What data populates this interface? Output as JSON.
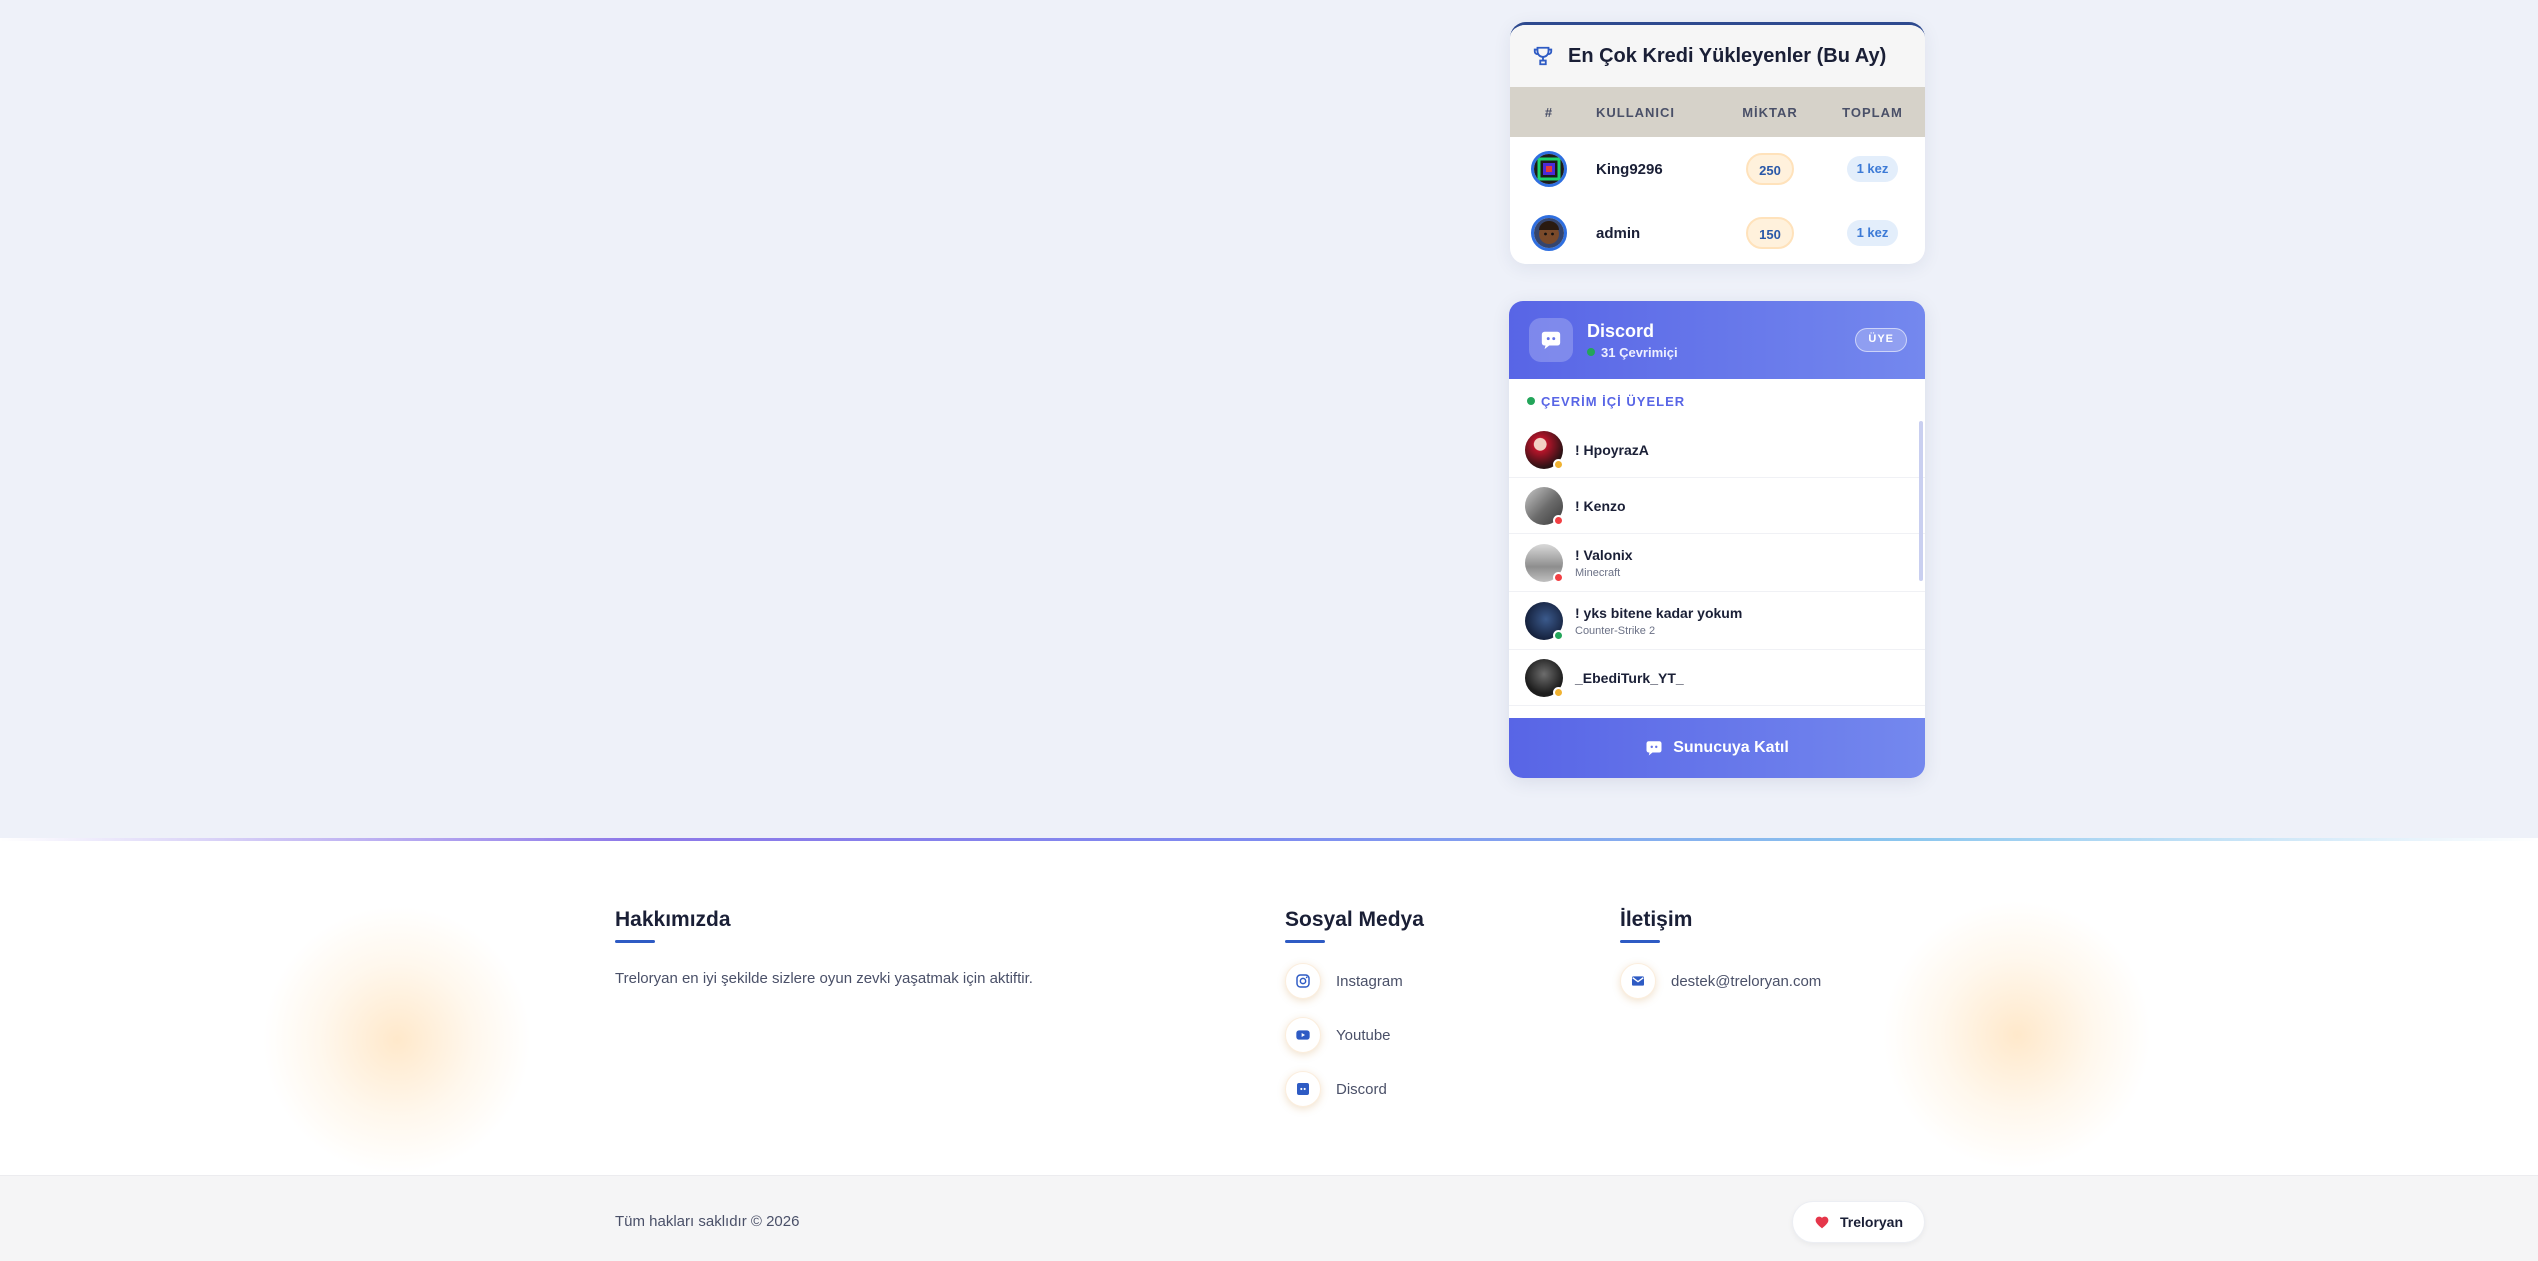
{
  "credits": {
    "title": "En Çok Kredi Yükleyenler (Bu Ay)",
    "columns": [
      "#",
      "KULLANICI",
      "MİKTAR",
      "TOPLAM"
    ],
    "rows": [
      {
        "user": "King9296",
        "amount": "250",
        "total": "1 kez"
      },
      {
        "user": "admin",
        "amount": "150",
        "total": "1 kez"
      }
    ]
  },
  "discord": {
    "name": "Discord",
    "online_text": "31 Çevrimiçi",
    "member_button": "ÜYE",
    "section_label": "ÇEVRİM İÇİ ÜYELER",
    "members": [
      {
        "name": "! HpoyrazA",
        "game": "",
        "status": "idle"
      },
      {
        "name": "! Kenzo",
        "game": "",
        "status": "dnd"
      },
      {
        "name": "! Valonix",
        "game": "Minecraft",
        "status": "dnd"
      },
      {
        "name": "! yks bitene kadar yokum",
        "game": "Counter-Strike 2",
        "status": "online"
      },
      {
        "name": "_EbediTurk_YT_",
        "game": "",
        "status": "idle"
      }
    ],
    "join_button": "Sunucuya Katıl"
  },
  "footer": {
    "about": {
      "title": "Hakkımızda",
      "text": "Treloryan en iyi şekilde sizlere oyun zevki yaşatmak için aktiftir."
    },
    "social": {
      "title": "Sosyal Medya",
      "links": [
        {
          "label": "Instagram",
          "icon": "instagram-icon"
        },
        {
          "label": "Youtube",
          "icon": "youtube-icon"
        },
        {
          "label": "Discord",
          "icon": "discord-icon"
        }
      ]
    },
    "contact": {
      "title": "İletişim",
      "email": "destek@treloryan.com"
    },
    "copyright": "Tüm hakları saklıdır © 2026",
    "brand": "Treloryan"
  },
  "colors": {
    "accent": "#2e5bc4",
    "discord": "#5865e6",
    "online": "#23a55a",
    "idle": "#f0b232",
    "dnd": "#f23f43"
  }
}
